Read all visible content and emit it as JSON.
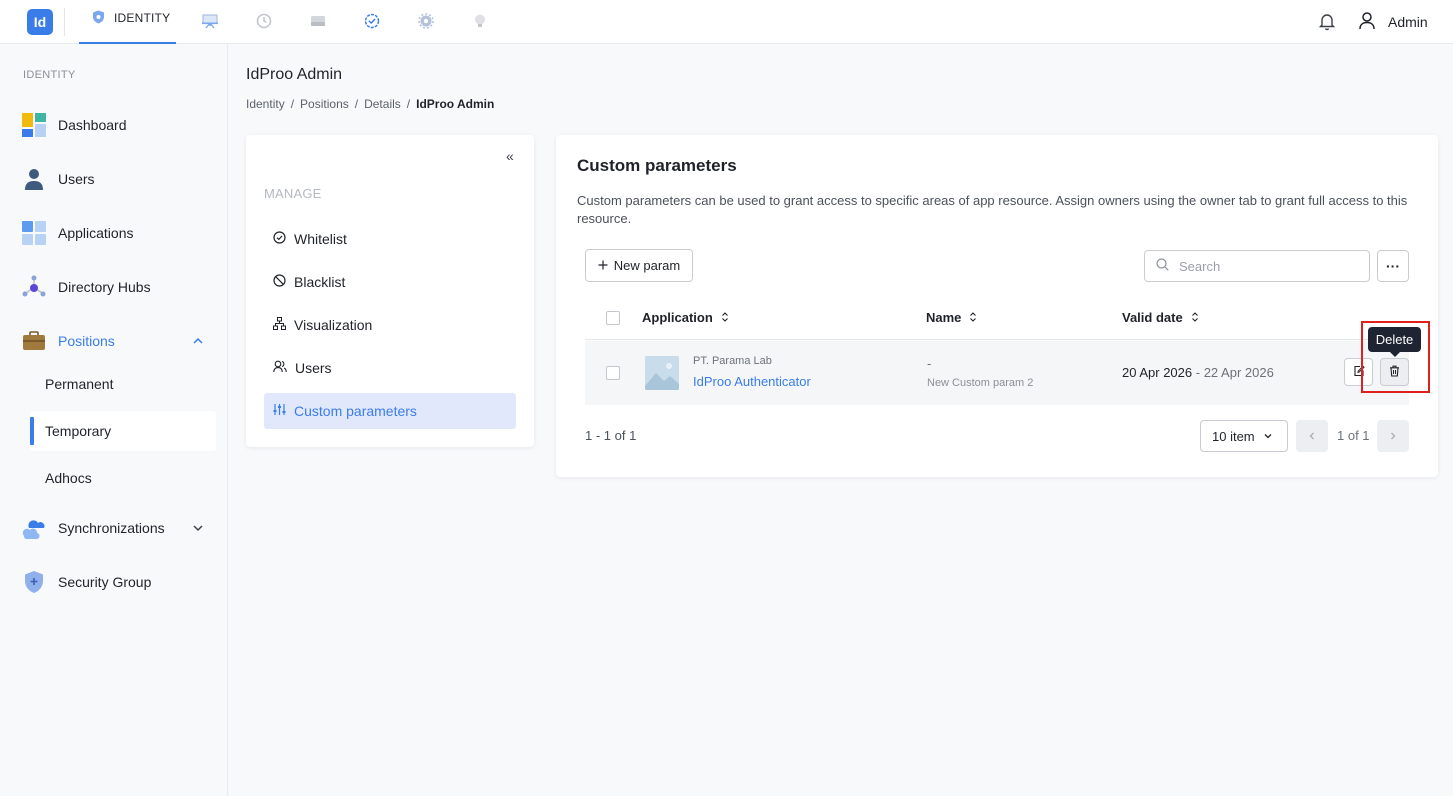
{
  "topbar": {
    "logo": "Id",
    "active_tab": "IDENTITY",
    "other_icons": [
      "presentation-icon",
      "history-icon",
      "drive-icon",
      "check-badge-icon",
      "gear-icon",
      "bulb-icon"
    ],
    "user": "Admin"
  },
  "sidebar": {
    "section": "IDENTITY",
    "items": [
      {
        "label": "Dashboard"
      },
      {
        "label": "Users"
      },
      {
        "label": "Applications"
      },
      {
        "label": "Directory Hubs"
      },
      {
        "label": "Positions"
      },
      {
        "label": "Synchronizations"
      },
      {
        "label": "Security Group"
      }
    ],
    "positions_sub": [
      "Permanent",
      "Temporary",
      "Adhocs"
    ],
    "active_sub": "Temporary"
  },
  "page": {
    "title": "IdProo Admin",
    "breadcrumbs": [
      "Identity",
      "Positions",
      "Details",
      "IdProo Admin"
    ]
  },
  "manage": {
    "collapse": "«",
    "label": "MANAGE",
    "items": [
      {
        "label": "Whitelist"
      },
      {
        "label": "Blacklist"
      },
      {
        "label": "Visualization"
      },
      {
        "label": "Users"
      },
      {
        "label": "Custom parameters"
      }
    ]
  },
  "custom": {
    "title": "Custom parameters",
    "description": "Custom parameters can be used to grant access to specific areas of app resource. Assign owners using the owner tab to grant full access to this resource.",
    "new_button": "New param",
    "search_placeholder": "Search",
    "more": "···",
    "columns": [
      "Application",
      "Name",
      "Valid date"
    ],
    "rows": [
      {
        "org": "PT. Parama Lab",
        "app": "IdProo Authenticator",
        "name_value": "-",
        "name_label": "New Custom param 2",
        "date_start": "20 Apr 2026",
        "date_sep": " - ",
        "date_end": "22 Apr 2026"
      }
    ],
    "tooltip": "Delete",
    "count": "1 - 1 of 1",
    "per_page": "10 item",
    "page_text": "1 of 1"
  },
  "colors": {
    "accent": "#3a7de8",
    "highlight": "#e0201c",
    "tooltip_bg": "#1f2433"
  }
}
